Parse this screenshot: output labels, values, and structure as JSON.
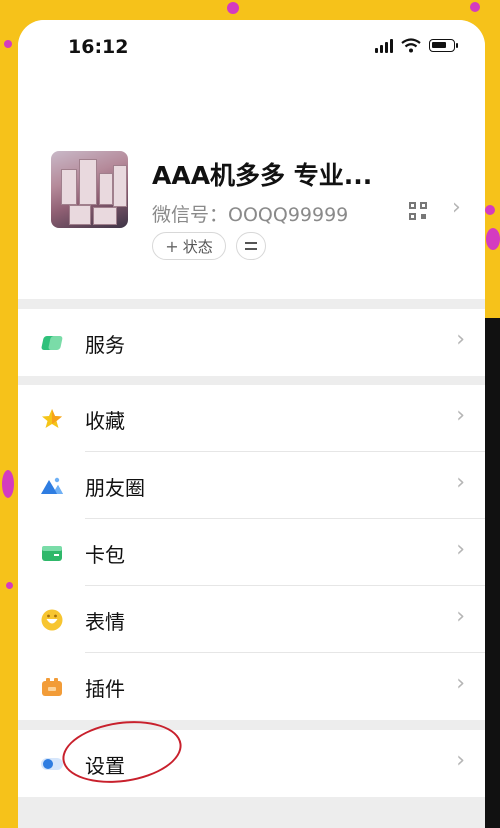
{
  "statusbar": {
    "time": "16:12"
  },
  "profile": {
    "nickname": "AAA机多多 专业...",
    "wechat_id": "微信号：OOQQ99999",
    "status_label": "状态",
    "status_plus": "+"
  },
  "services": {
    "label": "服务"
  },
  "items": [
    {
      "label": "收藏",
      "icon": "favorites-icon",
      "color": "#f5c518"
    },
    {
      "label": "朋友圈",
      "icon": "moments-icon",
      "color": "#2f7de1"
    },
    {
      "label": "卡包",
      "icon": "card-wallet-icon",
      "color": "#2fb86a"
    },
    {
      "label": "表情",
      "icon": "sticker-icon",
      "color": "#f7c530"
    },
    {
      "label": "插件",
      "icon": "plugin-icon",
      "color": "#f29c38"
    }
  ],
  "settings": {
    "label": "设置"
  },
  "colors": {
    "accent_green": "#30c17b",
    "settings_blue": "#2f7de1",
    "annotation_red": "#c8202c",
    "background_yellow": "#f6c21a"
  }
}
